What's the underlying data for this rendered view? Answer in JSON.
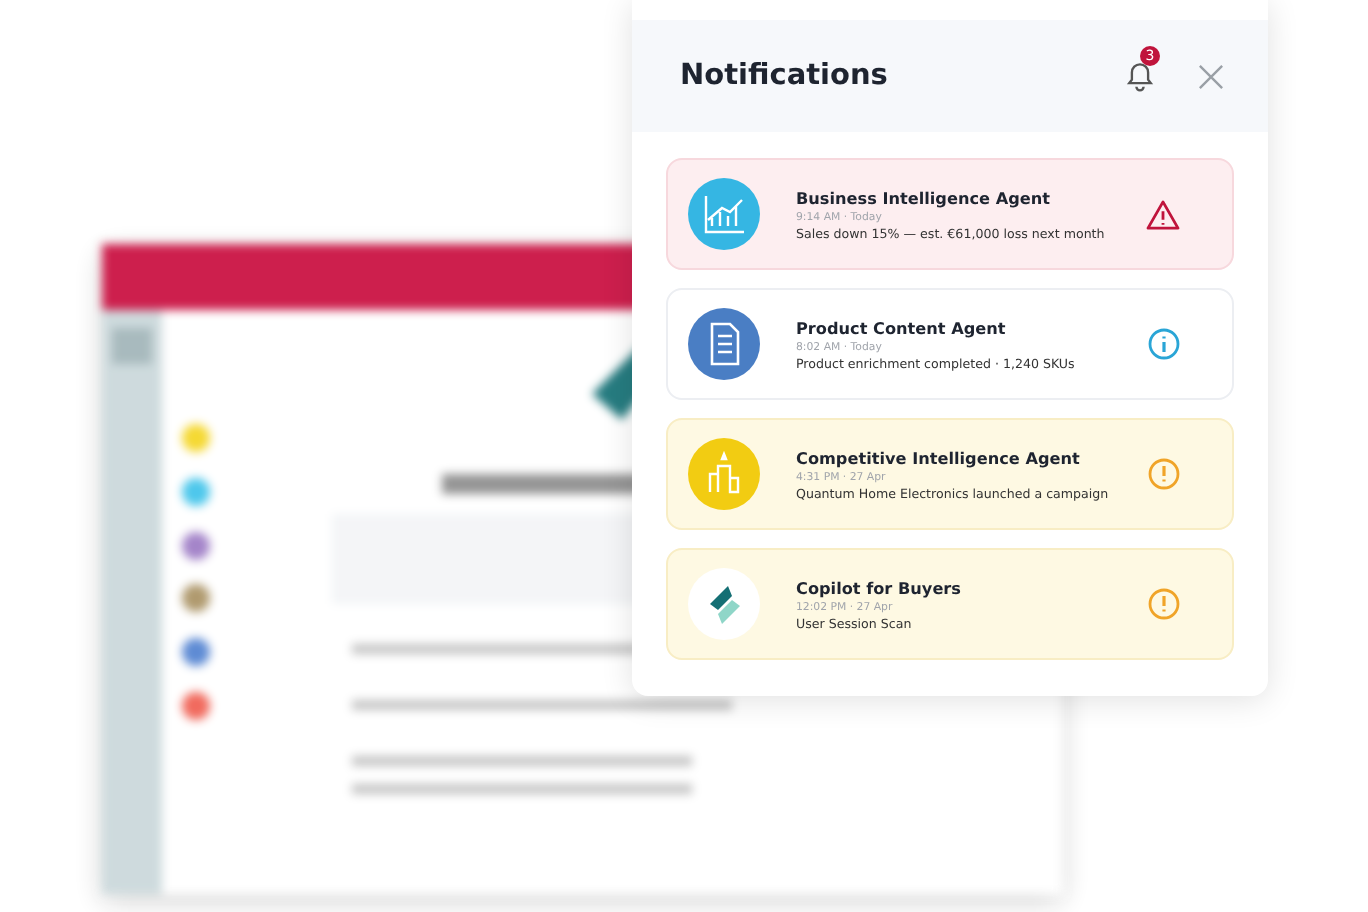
{
  "panel": {
    "title": "Notifications",
    "badge": "3"
  },
  "notifications": [
    {
      "title": "Business Intelligence Agent",
      "time": "9:14 AM · Today",
      "message": "Sales down 15% — est. €61,000 loss next month",
      "kind": "alert"
    },
    {
      "title": "Product Content Agent",
      "time": "8:02 AM · Today",
      "message": "Product enrichment completed · 1,240 SKUs",
      "kind": "info"
    },
    {
      "title": "Competitive Intelligence Agent",
      "time": "4:31 PM · 27 Apr",
      "message": "Quantum Home Electronics launched a campaign",
      "kind": "warning"
    },
    {
      "title": "Copilot for Buyers",
      "time": "12:02 PM · 27 Apr",
      "message": "User Session Scan",
      "kind": "warning"
    }
  ]
}
